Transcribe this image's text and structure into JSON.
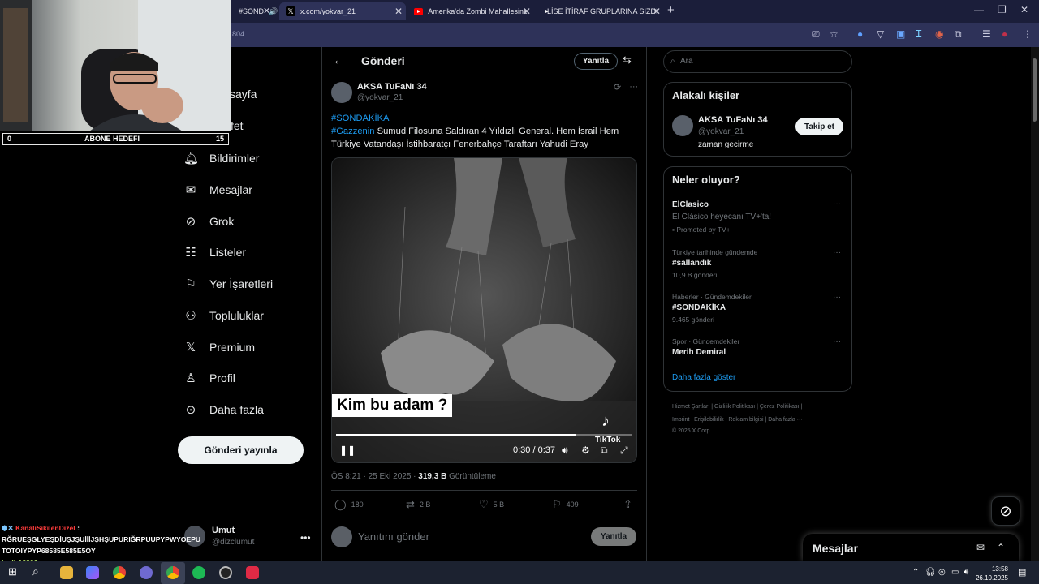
{
  "browser": {
    "tabs": [
      {
        "label": "#SOND"
      },
      {
        "label": "x.com/yokvar_21"
      },
      {
        "label": "Amerika'da Zombi Mahallesine"
      },
      {
        "label": "LİSE İTİRAF GRUPLARINA SIZDI"
      }
    ],
    "url_fragment": "804"
  },
  "overlay": {
    "abone_left": "0",
    "abone_label": "ABONE HEDEFİ",
    "abone_right": "15",
    "chat": [
      {
        "user": "KanaliSikilenDizel",
        "sep": ":"
      },
      {
        "text": "RĞRUEŞGLYEŞDİUŞJŞUİİİJŞHŞUPURIĞRPUUPYPWYOEPU"
      },
      {
        "text": "TOTOIYPYP68585E585E5OY"
      },
      {
        "user": "kadir12906",
        "sep": ":"
      }
    ]
  },
  "nav": {
    "partial_home": "sayfa",
    "partial_explore": "fet",
    "items": [
      {
        "label": "Bildirimler",
        "icon": "bell-icon"
      },
      {
        "label": "Mesajlar",
        "icon": "mail-icon"
      },
      {
        "label": "Grok",
        "icon": "grok-icon"
      },
      {
        "label": "Listeler",
        "icon": "list-icon"
      },
      {
        "label": "Yer İşaretleri",
        "icon": "bookmark-icon"
      },
      {
        "label": "Topluluklar",
        "icon": "communities-icon"
      },
      {
        "label": "Premium",
        "icon": "x-logo-icon"
      },
      {
        "label": "Profil",
        "icon": "person-icon"
      },
      {
        "label": "Daha fazla",
        "icon": "more-circle-icon"
      }
    ],
    "post_button": "Gönderi yayınla",
    "account": {
      "name": "Umut",
      "handle": "@dizclumut"
    }
  },
  "post_header": {
    "title": "Gönderi",
    "reply_label": "Yanıtla"
  },
  "post": {
    "author_name": "AKSA TuFaNı 34",
    "author_handle": "@yokvar_21",
    "hashtag1": "#SONDAKİKA",
    "hashtag2": "#Gazzenin",
    "text": " Sumud Filosuna Saldıran 4 Yıldızlı General. Hem İsrail Hem Türkiye Vatandaşı İstihbaratçı Fenerbahçe Taraftarı Yahudi Eray",
    "video_caption": "Kim bu adam ?",
    "video_time": "0:30 / 0:37",
    "video_progress": 0.81,
    "tiktok_label": "TikTok",
    "timestamp": "ÖS 8:21 · 25 Eki 2025 · ",
    "views": "319,3 B",
    "views_label": " Görüntüleme",
    "stats": {
      "replies": "180",
      "reposts": "2 B",
      "likes": "5 B",
      "bookmarks": "409"
    },
    "reply_placeholder": "Yanıtını gönder",
    "reply_button": "Yanıtla"
  },
  "sidebar": {
    "search_placeholder": "Ara",
    "relevant": {
      "title": "Alakalı kişiler",
      "name": "AKSA TuFaNı 34",
      "handle": "@yokvar_21",
      "bio": "zaman gecirme",
      "follow": "Takip et"
    },
    "trends": {
      "title": "Neler oluyor?",
      "promo_main": "ElClasico",
      "promo_sub": "El Clásico heyecanı TV+'ta!",
      "promo_by": "Promoted by TV+",
      "items": [
        {
          "context": "Türkiye tarihinde gündemde",
          "name": "#sallandık",
          "count": "10,9 B gönderi"
        },
        {
          "context": "Haberler · Gündemdekiler",
          "name": "#SONDAKİKA",
          "count": "9.465 gönderi"
        },
        {
          "context": "Spor · Gündemdekiler",
          "name": "Merih Demiral",
          "count": ""
        }
      ],
      "show_more": "Daha fazla göster"
    },
    "footer_line1": "Hizmet Şartları  |  Gizlilik Politikası  |  Çerez Politikası  |",
    "footer_line2": "Imprint  |  Erişilebilirlik  |  Reklam bilgisi  |  Daha fazla ···",
    "footer_line3": "© 2025 X Corp."
  },
  "messages_drawer": {
    "title": "Mesajlar"
  },
  "taskbar": {
    "time": "13:58",
    "date": "26.10.2025"
  }
}
